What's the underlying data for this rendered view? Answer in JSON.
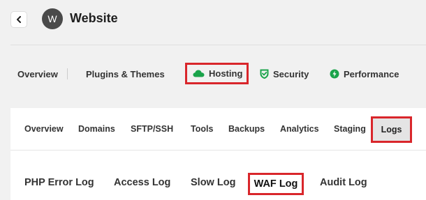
{
  "header": {
    "back_icon": "chevron-left-icon",
    "avatar_letter": "W",
    "site_title": "Website"
  },
  "main_nav": {
    "items": [
      {
        "label": "Overview"
      },
      {
        "label": "Plugins & Themes"
      },
      {
        "label": "Hosting",
        "icon": "cloud-icon",
        "active": true
      },
      {
        "label": "Security",
        "icon": "shield-icon"
      },
      {
        "label": "Performance",
        "icon": "bolt-icon"
      }
    ]
  },
  "sub_nav": {
    "items": [
      {
        "label": "Overview"
      },
      {
        "label": "Domains"
      },
      {
        "label": "SFTP/SSH"
      },
      {
        "label": "Tools"
      },
      {
        "label": "Backups"
      },
      {
        "label": "Analytics"
      },
      {
        "label": "Staging"
      },
      {
        "label": "Logs",
        "active": true
      }
    ]
  },
  "log_nav": {
    "items": [
      {
        "label": "PHP Error Log"
      },
      {
        "label": "Access Log"
      },
      {
        "label": "Slow Log"
      },
      {
        "label": "WAF Log",
        "active": true
      },
      {
        "label": "Audit Log"
      }
    ]
  },
  "colors": {
    "accent_green": "#1aa34a",
    "highlight_red": "#d9262b"
  }
}
